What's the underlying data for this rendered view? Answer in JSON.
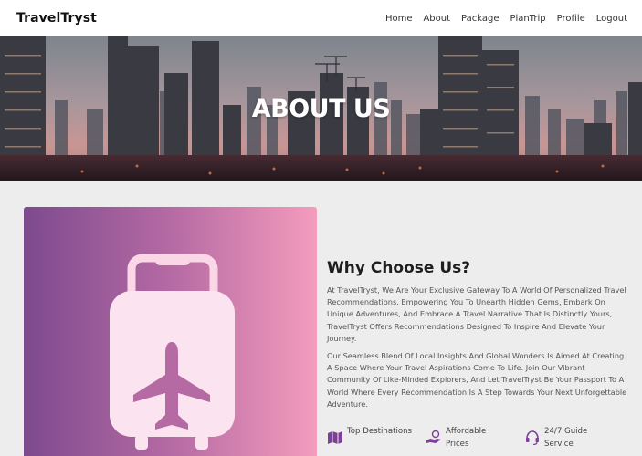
{
  "nav": {
    "brand": "TravelTryst",
    "links": [
      "Home",
      "About",
      "Package",
      "PlanTrip",
      "Profile",
      "Logout"
    ]
  },
  "hero": {
    "title": "ABOUT US"
  },
  "about": {
    "heading": "Why Choose Us?",
    "paragraph_1": "At TravelTryst, We Are Your Exclusive Gateway To A World Of Personalized Travel Recommendations. Empowering You To Unearth Hidden Gems, Embark On Unique Adventures, And Embrace A Travel Narrative That Is Distinctly Yours, TravelTryst Offers Recommendations Designed To Inspire And Elevate Your Journey.",
    "paragraph_2": "Our Seamless Blend Of Local Insights And Global Wonders Is Aimed At Creating A Space Where Your Travel Aspirations Come To Life. Join Our Vibrant Community Of Like-Minded Explorers, And Let TravelTryst Be Your Passport To A World Where Every Recommendation Is A Step Towards Your Next Unforgettable Adventure."
  },
  "features": [
    {
      "label": "Top Destinations",
      "icon": "map-icon"
    },
    {
      "label": "Affordable Prices",
      "icon": "hand-money-icon"
    },
    {
      "label": "24/7 Guide Service",
      "icon": "headset-icon"
    }
  ],
  "colors": {
    "accent": "#7d3f98",
    "gradient_start": "#7d4a8e",
    "gradient_end": "#f49cbd",
    "suitcase": "#fbe4ef",
    "plane": "#b56aa3"
  }
}
